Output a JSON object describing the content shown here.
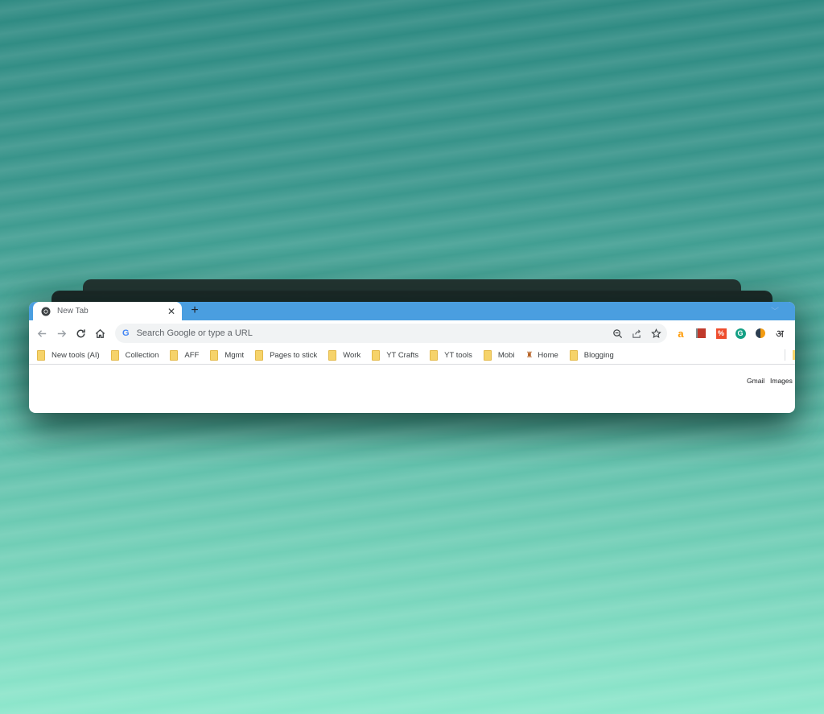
{
  "colors": {
    "tabstrip": "#4a9ee0",
    "toolbar_bg": "#ffffff",
    "omnibox_bg": "#f1f3f4",
    "folder": "#f6d36a"
  },
  "tab": {
    "title": "New Tab",
    "favicon": "chrome-icon",
    "close_icon": "close-icon"
  },
  "tabstrip": {
    "new_tab_icon": "plus-icon",
    "tab_search_icon": "chevron-down-icon"
  },
  "toolbar": {
    "back_icon": "back-arrow-icon",
    "forward_icon": "forward-arrow-icon",
    "reload_icon": "reload-icon",
    "home_icon": "home-icon",
    "omnibox_placeholder": "Search Google or type a URL",
    "omnibox_value": "",
    "zoom_icon": "zoom-out-icon",
    "share_icon": "share-icon",
    "bookmark_icon": "star-icon",
    "extensions": [
      {
        "name": "amazon-extension",
        "glyph": "a",
        "color": "#ff9900"
      },
      {
        "name": "book-extension",
        "glyph": "▮",
        "color": "#c0392b"
      },
      {
        "name": "percent-extension",
        "glyph": "%",
        "color": "#ee4d2d"
      },
      {
        "name": "grammarly-extension",
        "glyph": "G",
        "color": "#15a085"
      },
      {
        "name": "half-circle-extension",
        "glyph": "◐",
        "color": "#f39c12"
      },
      {
        "name": "hindi-extension",
        "glyph": "अ",
        "color": "#202124"
      }
    ]
  },
  "bookmarks": [
    {
      "label": "New tools (AI)",
      "icon": "folder-icon"
    },
    {
      "label": "Collection",
      "icon": "folder-icon"
    },
    {
      "label": "AFF",
      "icon": "folder-icon"
    },
    {
      "label": "Mgmt",
      "icon": "folder-icon"
    },
    {
      "label": "Pages to stick",
      "icon": "folder-icon"
    },
    {
      "label": "Work",
      "icon": "folder-icon"
    },
    {
      "label": "YT Crafts",
      "icon": "folder-icon"
    },
    {
      "label": "YT tools",
      "icon": "folder-icon"
    },
    {
      "label": "Mobi",
      "icon": "folder-icon"
    },
    {
      "label": "Home",
      "icon": "home-emblem-icon"
    },
    {
      "label": "Blogging",
      "icon": "folder-icon"
    }
  ],
  "content": {
    "gmail": "Gmail",
    "images": "Images"
  }
}
